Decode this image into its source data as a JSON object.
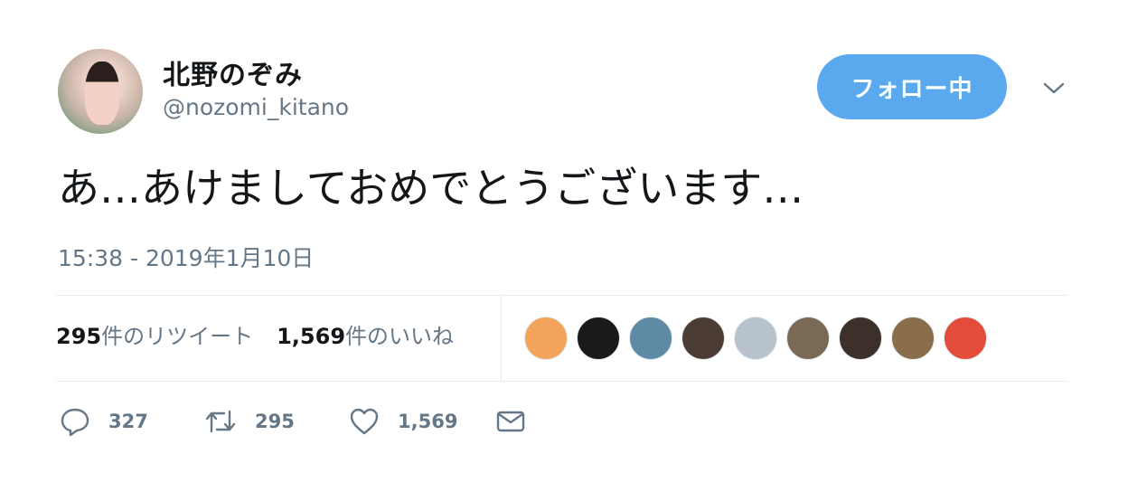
{
  "user": {
    "name": "北野のぞみ",
    "handle": "@nozomi_kitano"
  },
  "follow_button_label": "フォロー中",
  "tweet": {
    "text": "あ…あけましておめでとうございます…",
    "timestamp": "15:38 - 2019年1月10日"
  },
  "stats": {
    "retweets_count": "295",
    "retweets_label": "件のリツイート",
    "likes_count": "1,569",
    "likes_label": "件のいいね"
  },
  "likers": [
    {
      "color": "#f3a35a"
    },
    {
      "color": "#1a1a1a"
    },
    {
      "color": "#5e8aa6"
    },
    {
      "color": "#4b3d33"
    },
    {
      "color": "#b8c2cc"
    },
    {
      "color": "#7a6a55"
    },
    {
      "color": "#3d2f2a"
    },
    {
      "color": "#8a6d4a"
    },
    {
      "color": "#e34b3a"
    }
  ],
  "actions": {
    "replies": "327",
    "retweets": "295",
    "likes": "1,569"
  },
  "icons": {
    "reply": "reply-icon",
    "retweet": "retweet-icon",
    "like": "heart-icon",
    "dm": "envelope-icon",
    "more": "chevron-down-icon"
  },
  "colors": {
    "accent": "#5aa9ef",
    "muted": "#657786",
    "text": "#14171a",
    "divider": "#e6ecf0"
  }
}
